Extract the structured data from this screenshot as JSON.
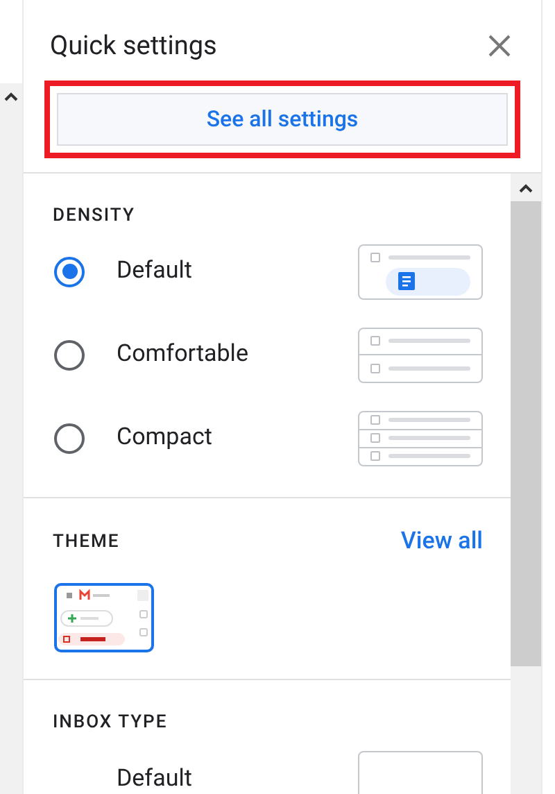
{
  "header": {
    "title": "Quick settings"
  },
  "see_all_button": {
    "label": "See all settings",
    "highlighted": true
  },
  "density": {
    "heading": "DENSITY",
    "options": [
      {
        "label": "Default",
        "selected": true,
        "kind": "default"
      },
      {
        "label": "Comfortable",
        "selected": false,
        "kind": "comfortable"
      },
      {
        "label": "Compact",
        "selected": false,
        "kind": "compact"
      }
    ]
  },
  "theme": {
    "heading": "THEME",
    "link": "View all",
    "thumbnail": {
      "selected": true
    }
  },
  "inbox_type": {
    "heading": "INBOX TYPE",
    "options": [
      {
        "label": "Default"
      }
    ]
  }
}
